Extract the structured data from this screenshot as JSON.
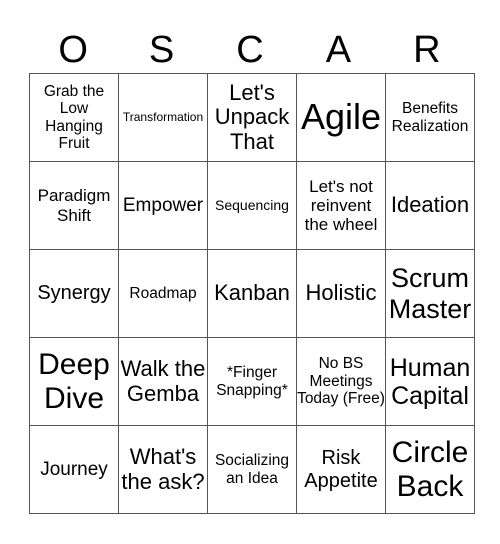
{
  "title_letters": [
    "O",
    "S",
    "C",
    "A",
    "R"
  ],
  "rows": [
    [
      "Grab the Low Hanging Fruit",
      "Transformation",
      "Let's Unpack That",
      "Agile",
      "Benefits Realization"
    ],
    [
      "Paradigm Shift",
      "Empower",
      "Sequencing",
      "Let's not reinvent the wheel",
      "Ideation"
    ],
    [
      "Synergy",
      "Roadmap",
      "Kanban",
      "Holistic",
      "Scrum Master"
    ],
    [
      "Deep Dive",
      "Walk the Gemba",
      "*Finger Snapping*",
      "No BS Meetings Today (Free)",
      "Human Capital"
    ],
    [
      "Journey",
      "What's the ask?",
      "Socializing an Idea",
      "Risk Appetite",
      "Circle Back"
    ]
  ]
}
